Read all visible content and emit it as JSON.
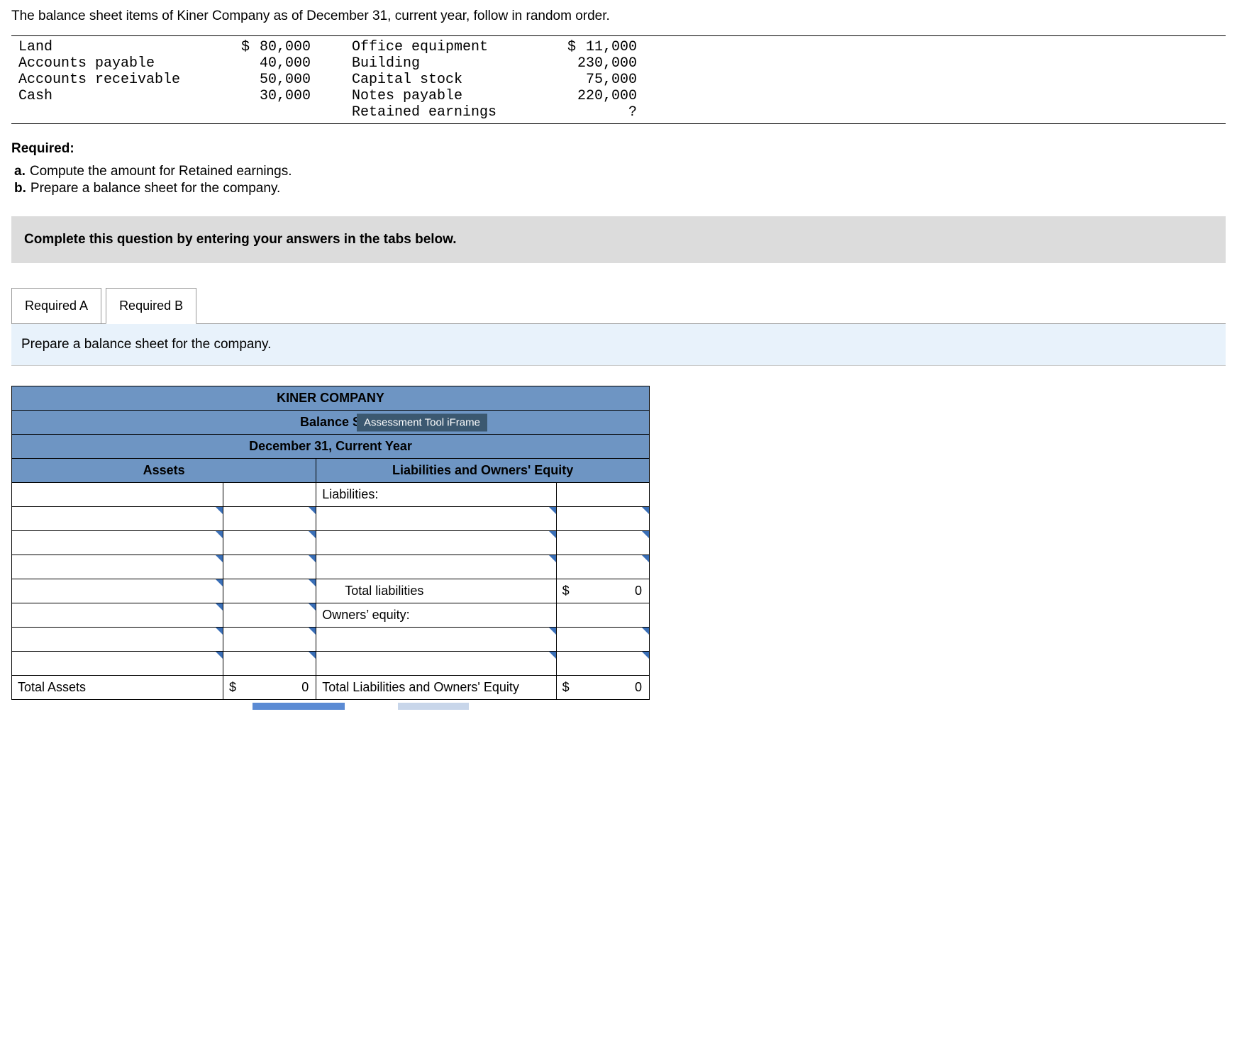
{
  "intro": "The balance sheet items of Kiner Company as of December 31, current year, follow in random order.",
  "items_left": [
    {
      "label": "Land",
      "cur": "$",
      "value": "80,000"
    },
    {
      "label": "Accounts payable",
      "cur": "",
      "value": "40,000"
    },
    {
      "label": "Accounts receivable",
      "cur": "",
      "value": "50,000"
    },
    {
      "label": "Cash",
      "cur": "",
      "value": "30,000"
    }
  ],
  "items_right": [
    {
      "label": "Office equipment",
      "cur": "$",
      "value": "11,000"
    },
    {
      "label": "Building",
      "cur": "",
      "value": "230,000"
    },
    {
      "label": "Capital stock",
      "cur": "",
      "value": "75,000"
    },
    {
      "label": "Notes payable",
      "cur": "",
      "value": "220,000"
    },
    {
      "label": "Retained earnings",
      "cur": "",
      "value": "?"
    }
  ],
  "required_head": "Required:",
  "req_a": {
    "letter": "a.",
    "text": "Compute the amount for Retained earnings."
  },
  "req_b": {
    "letter": "b.",
    "text": "Prepare a balance sheet for the company."
  },
  "instr": "Complete this question by entering your answers in the tabs below.",
  "tabs": {
    "a": "Required A",
    "b": "Required B"
  },
  "tab_note": "Prepare a balance sheet for the company.",
  "sheet": {
    "company": "KINER COMPANY",
    "title_prefix": "Balance S",
    "tooltip": "Assessment Tool iFrame",
    "date": "December 31, Current Year",
    "assets_head": "Assets",
    "liab_head": "Liabilities and Owners' Equity",
    "liabilities_label": "Liabilities:",
    "total_liab": "Total liabilities",
    "owners_eq": "Owners’ equity:",
    "total_assets": "Total Assets",
    "total_liab_eq": "Total Liabilities and Owners' Equity",
    "cur": "$",
    "zero": "0"
  }
}
